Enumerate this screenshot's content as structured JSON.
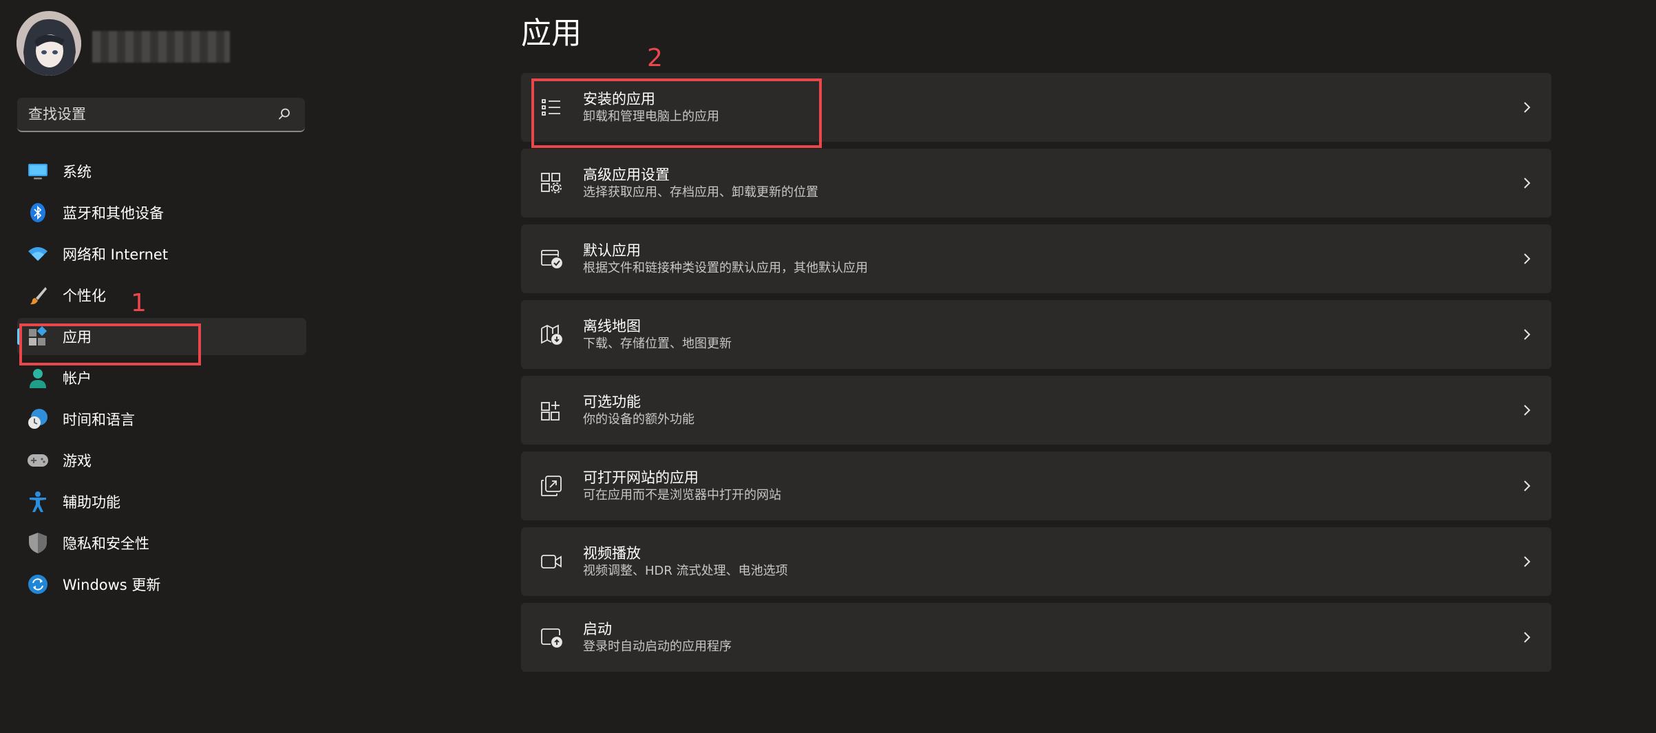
{
  "search": {
    "placeholder": "查找设置"
  },
  "sidebar": {
    "items": [
      {
        "label": "系统",
        "icon": "system-display-icon"
      },
      {
        "label": "蓝牙和其他设备",
        "icon": "bluetooth-icon"
      },
      {
        "label": "网络和 Internet",
        "icon": "wifi-icon"
      },
      {
        "label": "个性化",
        "icon": "brush-icon"
      },
      {
        "label": "应用",
        "icon": "apps-icon",
        "selected": true
      },
      {
        "label": "帐户",
        "icon": "account-icon"
      },
      {
        "label": "时间和语言",
        "icon": "time-language-icon"
      },
      {
        "label": "游戏",
        "icon": "gamepad-icon"
      },
      {
        "label": "辅助功能",
        "icon": "accessibility-icon"
      },
      {
        "label": "隐私和安全性",
        "icon": "shield-icon"
      },
      {
        "label": "Windows 更新",
        "icon": "update-icon"
      }
    ]
  },
  "main": {
    "title": "应用",
    "cards": [
      {
        "title": "安装的应用",
        "subtitle": "卸载和管理电脑上的应用",
        "icon": "list-icon"
      },
      {
        "title": "高级应用设置",
        "subtitle": "选择获取应用、存档应用、卸载更新的位置",
        "icon": "apps-gear-icon"
      },
      {
        "title": "默认应用",
        "subtitle": "根据文件和链接种类设置的默认应用，其他默认应用",
        "icon": "default-apps-icon"
      },
      {
        "title": "离线地图",
        "subtitle": "下载、存储位置、地图更新",
        "icon": "map-icon"
      },
      {
        "title": "可选功能",
        "subtitle": "你的设备的额外功能",
        "icon": "add-apps-icon"
      },
      {
        "title": "可打开网站的应用",
        "subtitle": "可在应用而不是浏览器中打开的网站",
        "icon": "open-web-icon"
      },
      {
        "title": "视频播放",
        "subtitle": "视频调整、HDR 流式处理、电池选项",
        "icon": "video-icon"
      },
      {
        "title": "启动",
        "subtitle": "登录时自动启动的应用程序",
        "icon": "startup-icon"
      }
    ]
  },
  "annotations": {
    "one": "1",
    "two": "2",
    "color": "#e8484c"
  },
  "colors": {
    "accent": "#60cdff",
    "background": "#1f1d1b",
    "card": "#2b2a28"
  }
}
